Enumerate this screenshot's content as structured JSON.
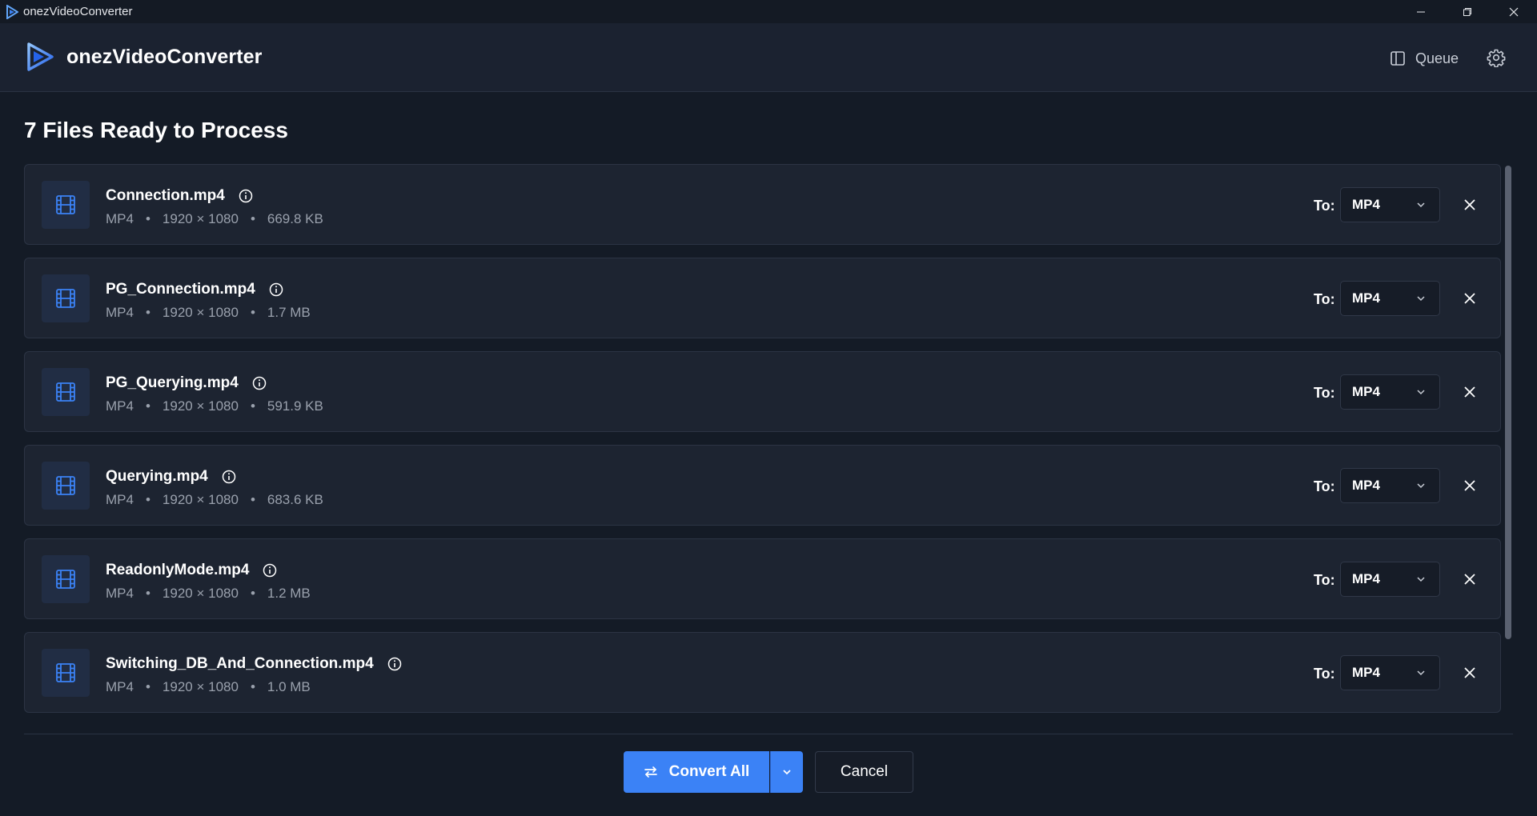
{
  "os_window": {
    "title": "onezVideoConverter"
  },
  "header": {
    "app_name": "onezVideoConverter",
    "queue_label": "Queue"
  },
  "main": {
    "title": "7 Files Ready to Process",
    "to_label": "To:",
    "files": [
      {
        "name": "Connection.mp4",
        "format": "MP4",
        "resolution": "1920 × 1080",
        "size": "669.8 KB",
        "target": "MP4"
      },
      {
        "name": "PG_Connection.mp4",
        "format": "MP4",
        "resolution": "1920 × 1080",
        "size": "1.7 MB",
        "target": "MP4"
      },
      {
        "name": "PG_Querying.mp4",
        "format": "MP4",
        "resolution": "1920 × 1080",
        "size": "591.9 KB",
        "target": "MP4"
      },
      {
        "name": "Querying.mp4",
        "format": "MP4",
        "resolution": "1920 × 1080",
        "size": "683.6 KB",
        "target": "MP4"
      },
      {
        "name": "ReadonlyMode.mp4",
        "format": "MP4",
        "resolution": "1920 × 1080",
        "size": "1.2 MB",
        "target": "MP4"
      },
      {
        "name": "Switching_DB_And_Connection.mp4",
        "format": "MP4",
        "resolution": "1920 × 1080",
        "size": "1.0 MB",
        "target": "MP4"
      }
    ]
  },
  "footer": {
    "convert_label": "Convert All",
    "cancel_label": "Cancel"
  },
  "colors": {
    "accent": "#3b82f6",
    "background": "#141b26",
    "card": "#1d2431",
    "icon_blue": "#3b82f6"
  },
  "icons": [
    "app-logo-icon",
    "minimize-icon",
    "restore-icon",
    "close-icon",
    "panel-icon",
    "gear-icon",
    "film-icon",
    "info-icon",
    "chevron-down-icon",
    "remove-icon",
    "swap-arrows-icon"
  ]
}
